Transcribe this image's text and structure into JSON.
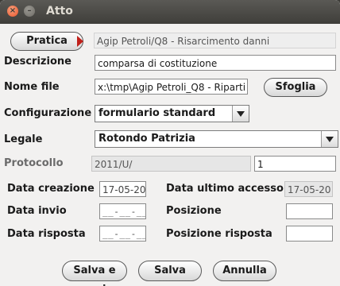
{
  "window": {
    "title": "Atto"
  },
  "pratica": {
    "button_label": "Pratica",
    "value": "Agip Petroli/Q8 - Risarcimento danni"
  },
  "descrizione": {
    "label": "Descrizione",
    "value": "comparsa di costituzione"
  },
  "nome_file": {
    "label": "Nome file",
    "value": "x:\\tmp\\Agip Petroli_Q8 - Riparti",
    "browse_label": "Sfoglia"
  },
  "configurazione": {
    "label": "Configurazione",
    "value": "formulario standard"
  },
  "legale": {
    "label": "Legale",
    "value": "Rotondo Patrizia"
  },
  "protocollo": {
    "label": "Protocollo",
    "value": "2011/U/",
    "number": "1"
  },
  "data_creazione": {
    "label": "Data creazione",
    "value": "17-05-20"
  },
  "data_ultimo_accesso": {
    "label": "Data ultimo accesso",
    "value": "17-05-20"
  },
  "data_invio": {
    "label": "Data invio",
    "value": "__-__-__"
  },
  "posizione": {
    "label": "Posizione",
    "value": ""
  },
  "data_risposta": {
    "label": "Data risposta",
    "value": "__-__-__"
  },
  "posizione_risposta": {
    "label": "Posizione risposta",
    "value": ""
  },
  "buttons": {
    "save_open": "Salva e apri",
    "save": "Salva",
    "cancel": "Annulla"
  }
}
